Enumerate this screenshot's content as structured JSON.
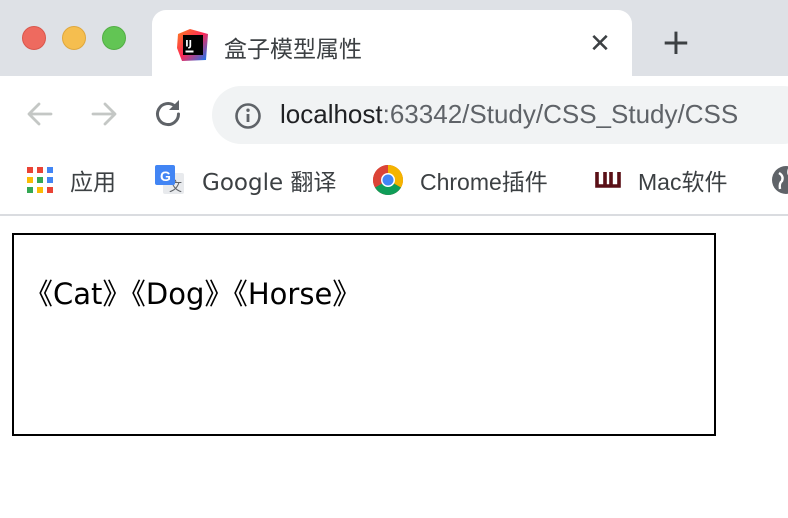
{
  "tab": {
    "title": "盒子模型属性",
    "favicon": "intellij-icon",
    "close_glyph": "✕"
  },
  "new_tab_glyph": "+",
  "toolbar": {
    "back_icon": "arrow-left-icon",
    "forward_icon": "arrow-right-icon",
    "reload_icon": "reload-icon",
    "info_icon": "info-icon",
    "url_host": "localhost",
    "url_rest": ":63342/Study/CSS_Study/CSS"
  },
  "bookmarks": [
    {
      "label": "应用",
      "icon": "apps-grid-icon"
    },
    {
      "label": "Google 翻译",
      "icon": "google-translate-icon"
    },
    {
      "label": "Chrome插件",
      "icon": "chrome-icon"
    },
    {
      "label": "Mac软件",
      "icon": "w-logo-icon"
    }
  ],
  "page": {
    "box_text": "《Cat》《Dog》《Horse》"
  },
  "colors": {
    "tabstrip_bg": "#dee1e6",
    "omnibox_bg": "#f1f3f4",
    "close": "#ee6a5f",
    "minimize": "#f5be4f",
    "maximize": "#62c554"
  }
}
